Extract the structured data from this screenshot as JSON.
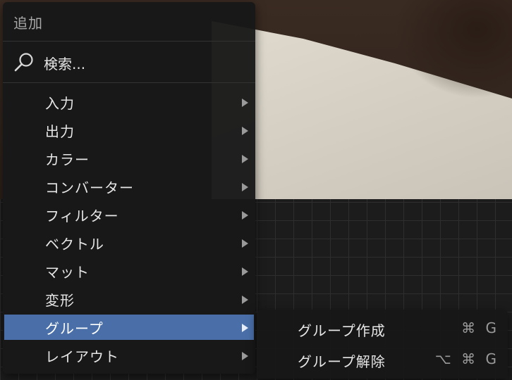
{
  "menu": {
    "title": "追加",
    "search_label": "検索...",
    "items": [
      {
        "label": "入力",
        "has_submenu": true
      },
      {
        "label": "出力",
        "has_submenu": true
      },
      {
        "label": "カラー",
        "has_submenu": true
      },
      {
        "label": "コンバーター",
        "has_submenu": true
      },
      {
        "label": "フィルター",
        "has_submenu": true
      },
      {
        "label": "ベクトル",
        "has_submenu": true
      },
      {
        "label": "マット",
        "has_submenu": true
      },
      {
        "label": "変形",
        "has_submenu": true
      },
      {
        "label": "グループ",
        "has_submenu": true,
        "active": true
      },
      {
        "label": "レイアウト",
        "has_submenu": true
      }
    ]
  },
  "submenu": {
    "items": [
      {
        "label": "グループ作成",
        "shortcut": "⌘ G"
      },
      {
        "label": "グループ解除",
        "shortcut": "⌥ ⌘ G"
      }
    ]
  },
  "colors": {
    "menu_bg": "#181818",
    "highlight": "#4a6fa8",
    "text": "#e6e6e6",
    "muted": "#9a9a9a"
  }
}
